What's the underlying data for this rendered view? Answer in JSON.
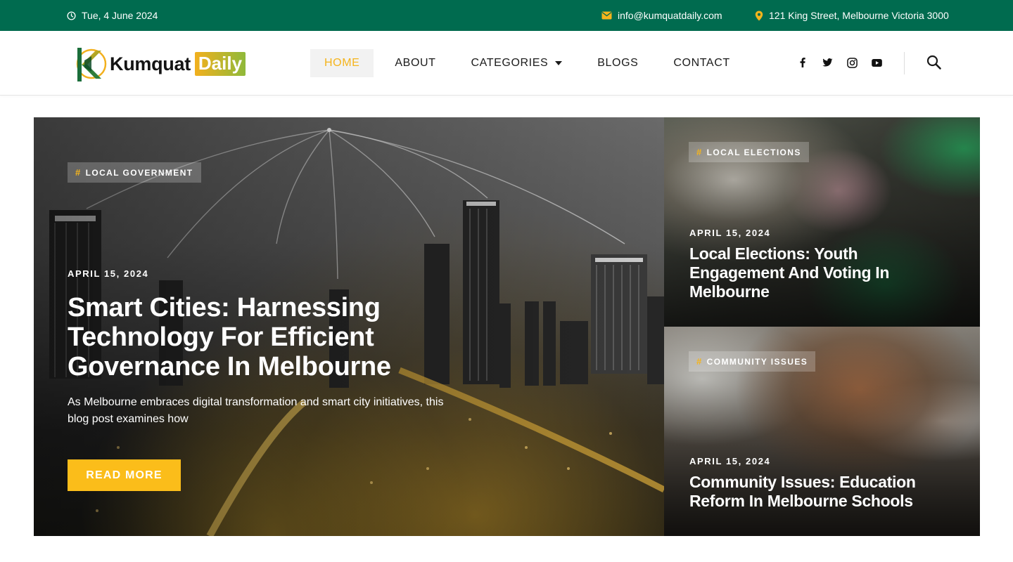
{
  "topbar": {
    "date": "Tue, 4 June 2024",
    "email": "info@kumquatdaily.com",
    "address": "121 King Street, Melbourne Victoria 3000",
    "date_icon": "clock-icon",
    "email_icon": "envelope-icon",
    "address_icon": "map-pin-icon"
  },
  "logo": {
    "word": "Kumquat",
    "badge": "Daily"
  },
  "nav": {
    "items": [
      {
        "label": "HOME"
      },
      {
        "label": "ABOUT"
      },
      {
        "label": "CATEGORIES"
      },
      {
        "label": "BLOGS"
      },
      {
        "label": "CONTACT"
      }
    ],
    "active_index": 0
  },
  "social": {
    "icons": [
      "facebook-icon",
      "twitter-icon",
      "instagram-icon",
      "youtube-icon"
    ]
  },
  "search": {
    "icon": "search-icon"
  },
  "hero": {
    "tag": "LOCAL GOVERNMENT",
    "date": "APRIL 15, 2024",
    "title": "Smart Cities: Harnessing Technology For Efficient Governance In Melbourne",
    "excerpt": "As Melbourne embraces digital transformation and smart city initiatives, this blog post examines how",
    "button": "READ MORE"
  },
  "cards": [
    {
      "tag": "LOCAL ELECTIONS",
      "date": "APRIL 15, 2024",
      "title": "Local Elections: Youth Engagement And Voting In Melbourne"
    },
    {
      "tag": "COMMUNITY ISSUES",
      "date": "APRIL 15, 2024",
      "title": "Community Issues: Education Reform In Melbourne Schools"
    }
  ],
  "colors": {
    "topbar": "#006b4f",
    "accent": "#fbbd1a",
    "nav_active": "#f5b41c"
  }
}
